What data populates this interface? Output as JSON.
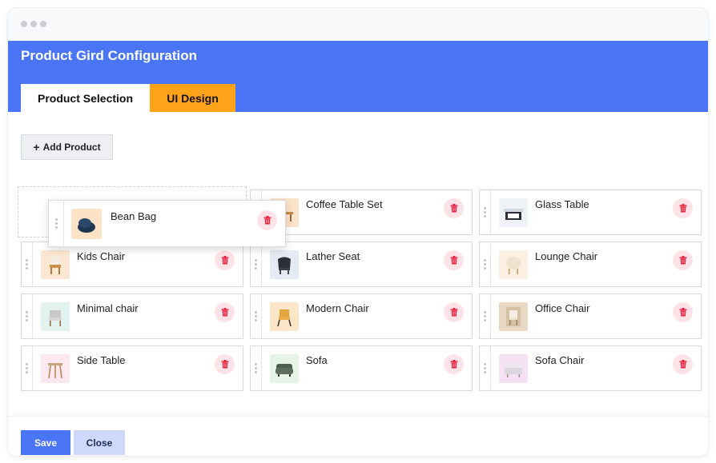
{
  "window": {
    "title": "Product Gird Configuration"
  },
  "tabs": [
    {
      "label": "Product Selection",
      "active": true
    },
    {
      "label": "UI Design",
      "active": false
    }
  ],
  "toolbar": {
    "add_icon": "+",
    "add_label": "Add Product"
  },
  "dragging_item": {
    "name": "Bean Bag",
    "icon": "bean-bag-icon"
  },
  "products": [
    {
      "name": "Coffee Table Set",
      "icon": "coffee-table-set-icon"
    },
    {
      "name": "Glass Table",
      "icon": "glass-table-icon"
    },
    {
      "name": "Kids Chair",
      "icon": "kids-chair-icon"
    },
    {
      "name": "Lather Seat",
      "icon": "lather-seat-icon"
    },
    {
      "name": "Lounge Chair",
      "icon": "lounge-chair-icon"
    },
    {
      "name": "Minimal chair",
      "icon": "minimal-chair-icon"
    },
    {
      "name": "Modern Chair",
      "icon": "modern-chair-icon"
    },
    {
      "name": "Office Chair",
      "icon": "office-chair-icon"
    },
    {
      "name": "Side Table",
      "icon": "side-table-icon"
    },
    {
      "name": "Sofa",
      "icon": "sofa-icon"
    },
    {
      "name": "Sofa Chair",
      "icon": "sofa-chair-icon"
    }
  ],
  "footer": {
    "save_label": "Save",
    "close_label": "Close"
  },
  "colors": {
    "header": "#4a75f7",
    "tab_ui": "#ffa41a",
    "delete_bg": "#fde3e7",
    "delete_icon": "#e8213f"
  }
}
